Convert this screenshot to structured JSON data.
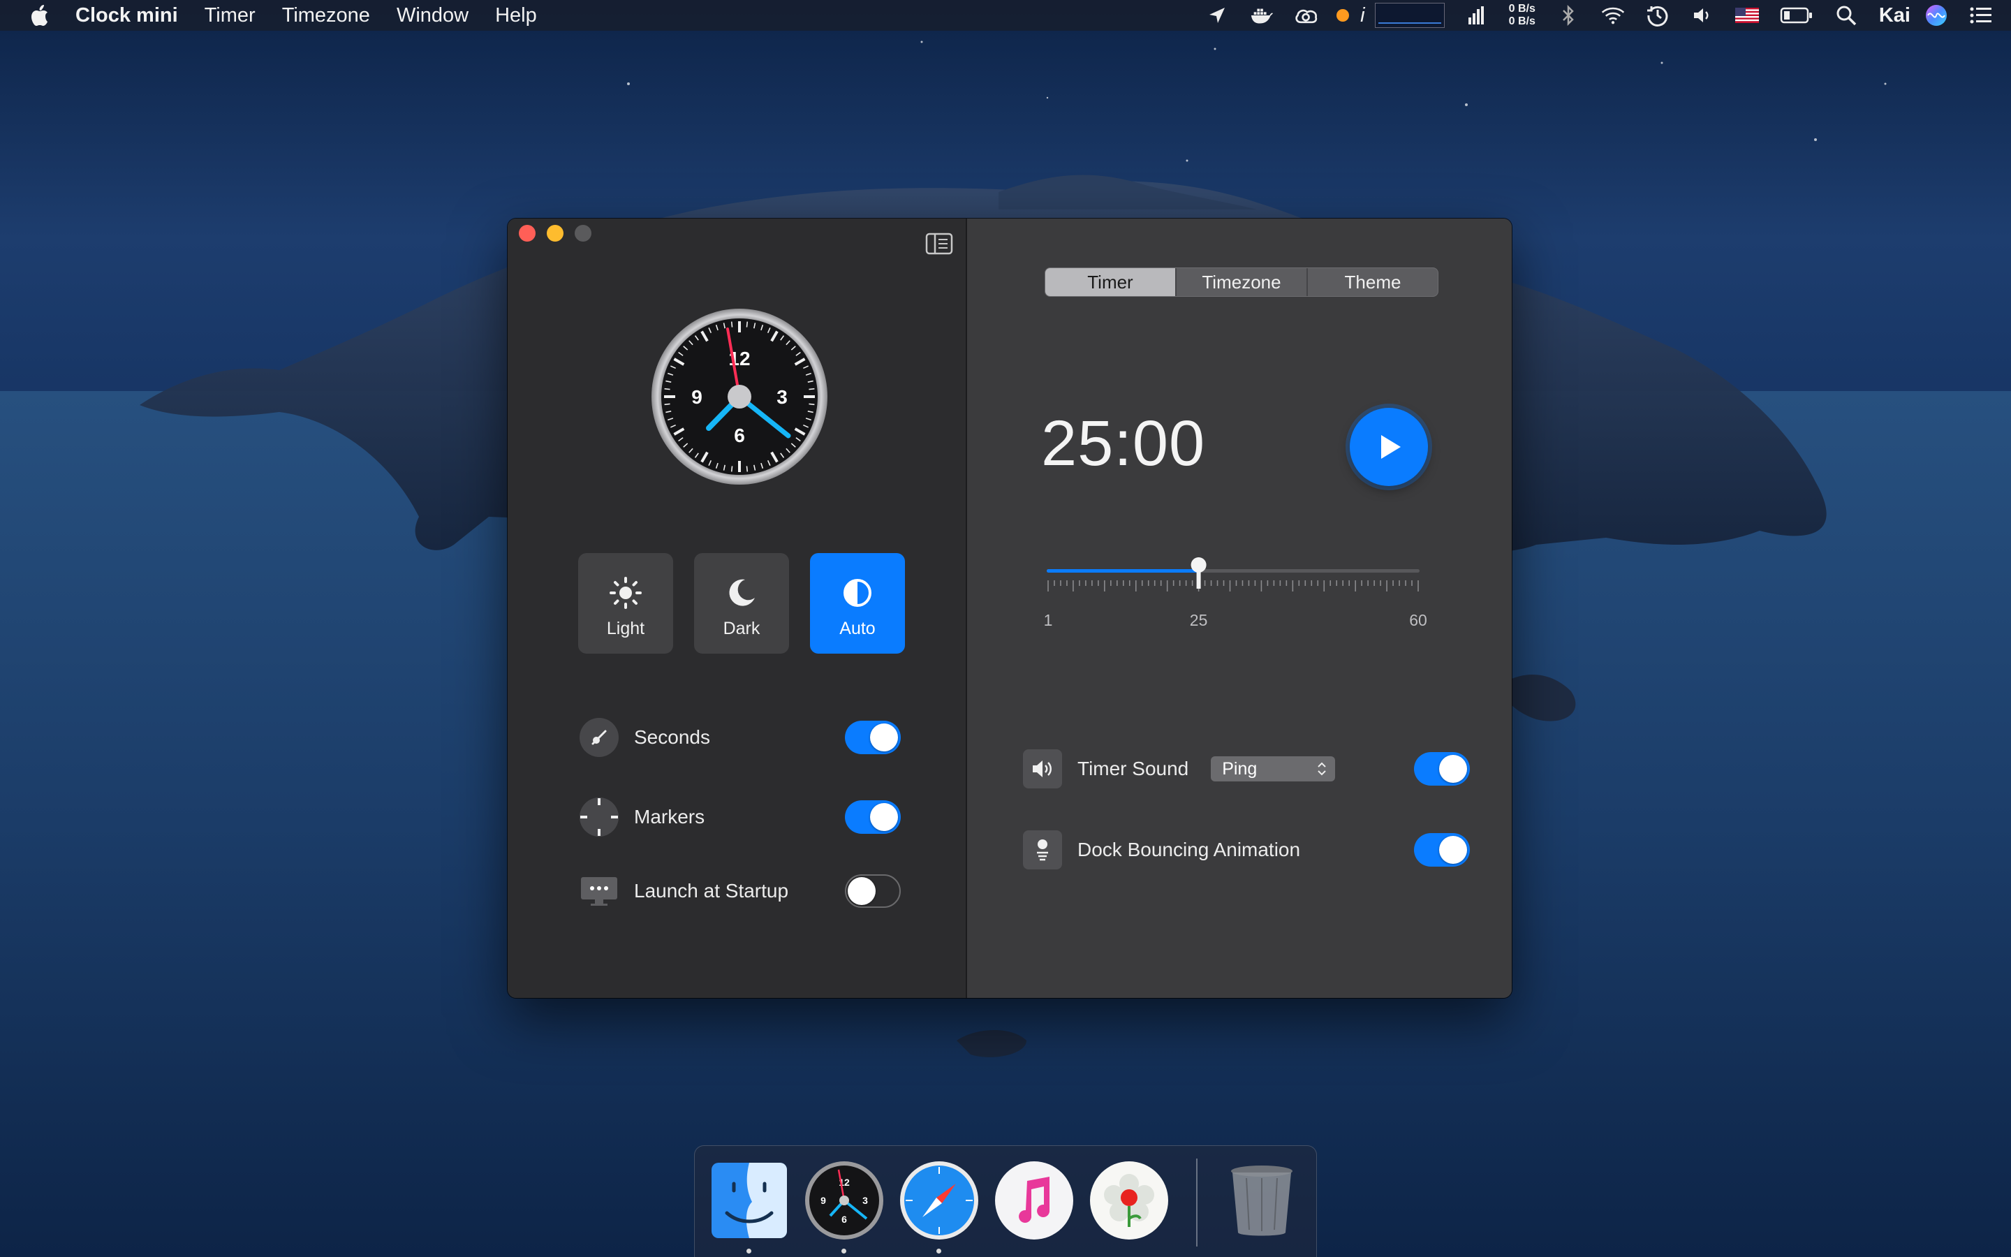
{
  "menubar": {
    "app_name": "Clock mini",
    "menus": [
      "Timer",
      "Timezone",
      "Window",
      "Help"
    ],
    "net_up": "0 B/s",
    "net_down": "0 B/s",
    "italic_i": "i",
    "user_name": "Kai",
    "icons": [
      "location-arrow-icon",
      "docker-icon",
      "creative-cloud-icon",
      "orange-dot-icon",
      "info-icon",
      "network-graph-icon",
      "signal-bars-icon",
      "bluetooth-icon",
      "wifi-icon",
      "time-machine-icon",
      "volume-icon",
      "us-flag-icon",
      "battery-icon",
      "spotlight-icon",
      "siri-icon",
      "notification-center-icon"
    ]
  },
  "sidebar": {
    "themes": [
      {
        "label": "Light",
        "icon": "sun-icon",
        "active": false
      },
      {
        "label": "Dark",
        "icon": "moon-icon",
        "active": false
      },
      {
        "label": "Auto",
        "icon": "half-circle-icon",
        "active": true
      }
    ],
    "settings": [
      {
        "label": "Seconds",
        "icon": "second-hand-icon",
        "enabled": true
      },
      {
        "label": "Markers",
        "icon": "markers-icon",
        "enabled": true
      },
      {
        "label": "Launch at Startup",
        "icon": "display-icon",
        "enabled": false
      }
    ],
    "clock_numerals": [
      "12",
      "3",
      "6",
      "9"
    ]
  },
  "main": {
    "tabs": [
      {
        "label": "Timer",
        "selected": true
      },
      {
        "label": "Timezone",
        "selected": false
      },
      {
        "label": "Theme",
        "selected": false
      }
    ],
    "timer_display": "25:00",
    "slider": {
      "min": 1,
      "max": 60,
      "value": 25,
      "min_label": "1",
      "value_label": "25",
      "max_label": "60"
    },
    "timer_sound": {
      "label": "Timer Sound",
      "selected": "Ping",
      "enabled": true
    },
    "dock_bouncing": {
      "label": "Dock Bouncing Animation",
      "enabled": true
    }
  },
  "dock": {
    "apps": [
      "Finder",
      "Clock mini",
      "Safari",
      "iTunes",
      "Photo app",
      "Trash"
    ],
    "running": [
      "Finder",
      "Clock mini",
      "Safari"
    ]
  },
  "colors": {
    "accent": "#0a7cff",
    "sidebar_bg": "#2c2c2e",
    "main_bg": "#3b3b3d",
    "second_hand": "#ff2d55",
    "clock_hands": "#16b6f7"
  }
}
